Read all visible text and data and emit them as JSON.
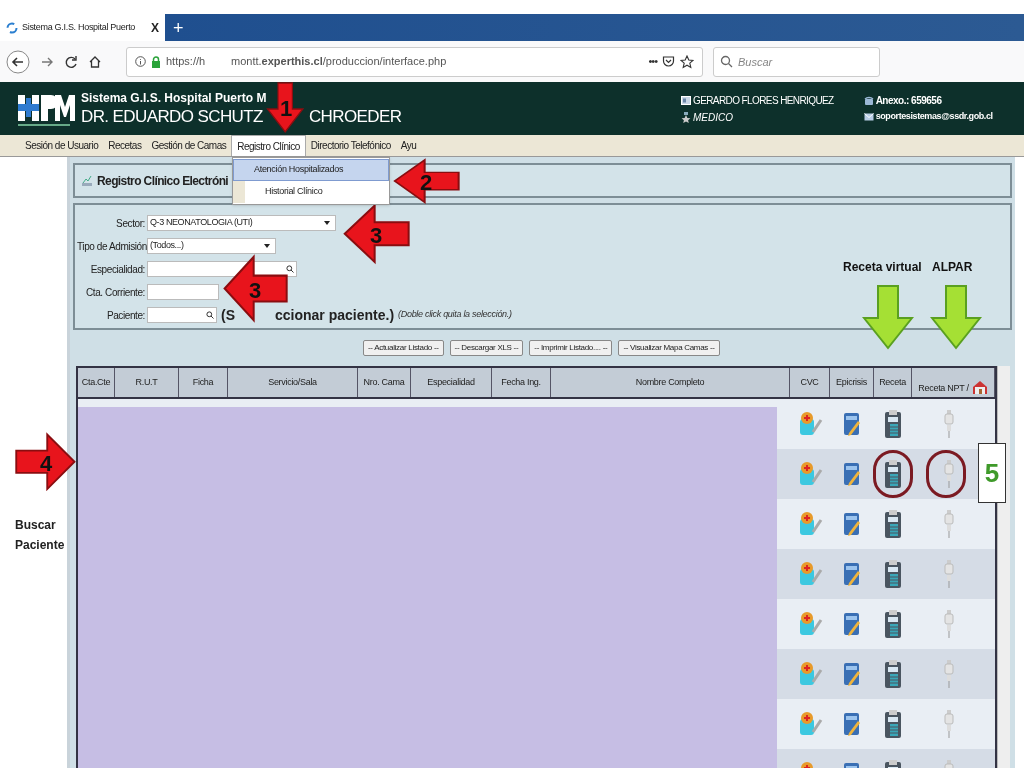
{
  "browser": {
    "tab_title": "Sistema G.I.S. Hospital Puerto",
    "tab_close": "X",
    "new_tab": "+",
    "url_start": "https://h",
    "url_end": "montt.**experthis.cl**/produccion/interface.php",
    "page_actions": "•••",
    "search_placeholder": "Buscar"
  },
  "header": {
    "system": "Sistema G.I.S. Hospital Puerto M",
    "doctor_left": "DR. EDUARDO SCHUTZ",
    "doctor_right": "CHROEDER",
    "user": "GERARDO FLORES HENRIQUEZ",
    "role": "MEDICO",
    "phone": "Anexo.: 659656",
    "email": "soportesistemas@ssdr.gob.cl"
  },
  "menu": [
    {
      "label": "Sesión de Usuario",
      "selected": false
    },
    {
      "label": "Recetas",
      "selected": false
    },
    {
      "label": "Gestión de Camas",
      "selected": false
    },
    {
      "label": "Registro Clínico",
      "selected": true
    },
    {
      "label": "Directorio Telefónico",
      "selected": false
    },
    {
      "label": "Ayu",
      "selected": false
    }
  ],
  "dropdown": [
    {
      "label": "Atención Hospitalizados",
      "selected": true
    },
    {
      "label": "Historial Clínico",
      "selected": false
    }
  ],
  "sidebar": {
    "label": "Buscar Paciente"
  },
  "panel_title": "Registro Clínico Electróni",
  "filters": [
    {
      "label": "Sector:",
      "kind": "select",
      "value": "Q-3 NEONATOLOGIA (UTI)"
    },
    {
      "label": "Tipo de Admisión:",
      "kind": "select",
      "value": "(Todos...)"
    },
    {
      "label": "Especialidad:",
      "kind": "search"
    },
    {
      "label": "Cta. Corriente:",
      "kind": "text"
    },
    {
      "label": "Paciente:",
      "kind": "patient"
    }
  ],
  "patient_hint": {
    "start": "(S",
    "end": "ccionar paciente.)",
    "note": "(Doble click quita la selección.)"
  },
  "buttons": [
    "-- Actualizar Listado --",
    "-- Descargar XLS --",
    "-- Imprimir Listado.... --",
    "-- Visualizar Mapa Camas --"
  ],
  "table": {
    "columns": [
      "Cta.Cte",
      "R.U.T",
      "Ficha",
      "Servicio/Sala",
      "Nro. Cama",
      "Especialidad",
      "Fecha Ing.",
      "Nombre Completo",
      "CVC",
      "Epicrisis",
      "Receta",
      "Receta NPT /"
    ],
    "rows": [
      {
        "circled": false
      },
      {
        "circled": true
      },
      {
        "circled": false
      },
      {
        "circled": false
      },
      {
        "circled": false
      },
      {
        "circled": false
      },
      {
        "circled": false
      },
      {
        "circled": false
      }
    ]
  },
  "annotations": {
    "arrows": [
      {
        "kind": "down",
        "label": "1"
      },
      {
        "kind": "left",
        "label": "2"
      },
      {
        "kind": "left",
        "label": "3"
      },
      {
        "kind": "left",
        "label": "3"
      },
      {
        "kind": "right",
        "label": "4"
      }
    ],
    "green_arrows": [
      {
        "label": "Receta virtual"
      },
      {
        "label": "ALPAR"
      }
    ],
    "step_box": "5"
  }
}
